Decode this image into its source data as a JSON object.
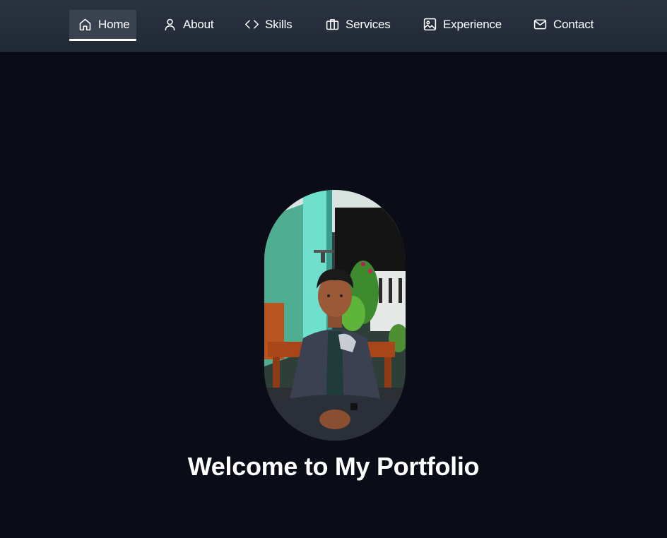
{
  "nav": {
    "items": [
      {
        "label": "Home",
        "icon": "home-icon",
        "active": true
      },
      {
        "label": "About",
        "icon": "user-icon",
        "active": false
      },
      {
        "label": "Skills",
        "icon": "code-icon",
        "active": false
      },
      {
        "label": "Services",
        "icon": "briefcase-icon",
        "active": false
      },
      {
        "label": "Experience",
        "icon": "image-icon",
        "active": false
      },
      {
        "label": "Contact",
        "icon": "mail-icon",
        "active": false
      }
    ]
  },
  "hero": {
    "title": "Welcome to My Portfolio"
  },
  "colors": {
    "background": "#0a0d18",
    "navbar": "#262d3a",
    "active_tab": "#3a4250",
    "text": "#ffffff"
  }
}
